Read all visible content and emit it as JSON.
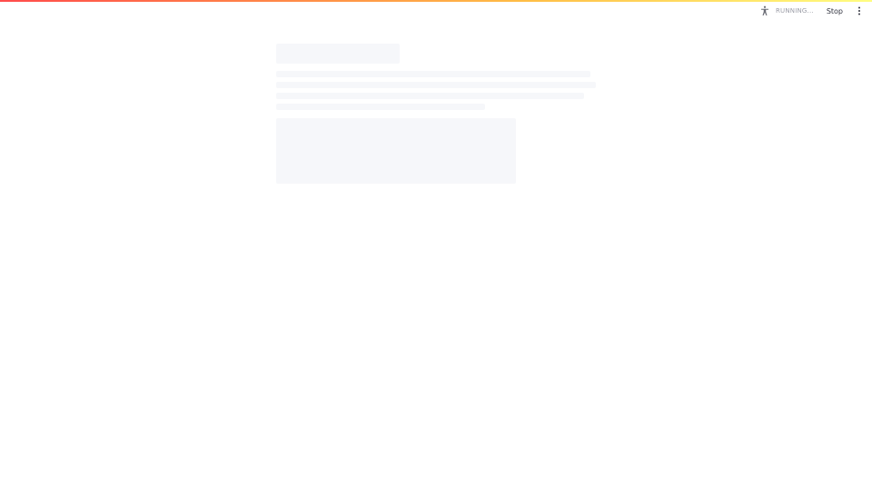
{
  "header": {
    "decoration_colors": [
      "#ff4b4b",
      "#ffbd45",
      "#fffd80"
    ],
    "status": {
      "icon": "running-person-icon",
      "text": "RUNNING..."
    },
    "stop_label": "Stop",
    "menu_icon": "kebab-menu-icon"
  },
  "main": {
    "state": "loading-skeleton",
    "skeleton_color": "#f0f2f6"
  }
}
